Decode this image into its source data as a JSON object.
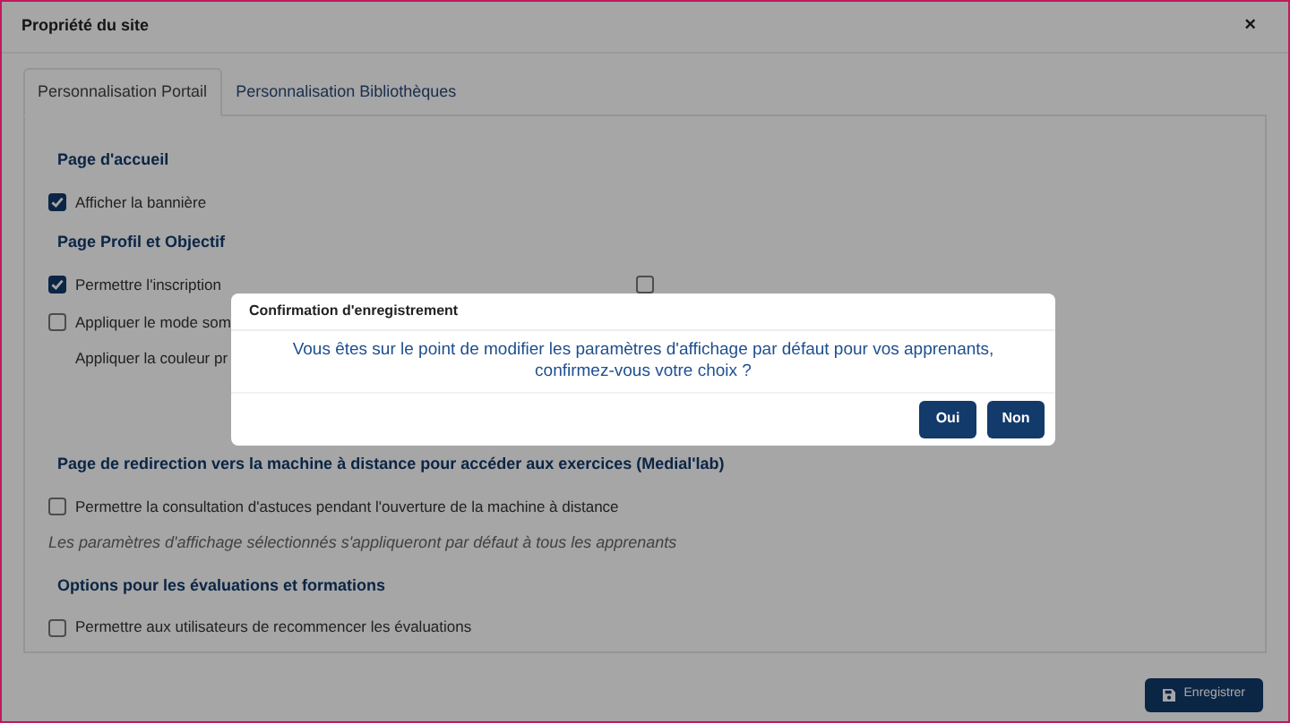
{
  "dialog": {
    "title": "Propriété du site",
    "close": "×"
  },
  "tabs": [
    {
      "label": "Personnalisation Portail",
      "selected": true
    },
    {
      "label": "Personnalisation Bibliothèques",
      "selected": false
    }
  ],
  "sections": [
    {
      "heading": "Page d'accueil",
      "items": [
        {
          "kind": "checkbox",
          "label": "Afficher la bannière",
          "checked": true
        }
      ]
    },
    {
      "heading": "Page Profil et Objectif",
      "items": [
        {
          "kind": "checkbox-row",
          "cells": [
            {
              "label": "Permettre l'inscription",
              "checked": true
            },
            {
              "checked": false
            }
          ]
        },
        {
          "kind": "checkbox",
          "label": "Appliquer le mode som",
          "checked": false
        },
        {
          "kind": "subtext",
          "text": "Appliquer la couleur pr"
        }
      ]
    },
    {
      "heading": "Page de redirection vers la machine à distance pour accéder aux exercices (Medial'lab)",
      "items": [
        {
          "kind": "checkbox",
          "label": "Permettre la consultation d'astuces pendant l'ouverture de la machine à distance",
          "checked": false
        },
        {
          "kind": "note",
          "text": "Les paramètres d'affichage sélectionnés s'appliqueront par défaut à tous les apprenants"
        }
      ]
    },
    {
      "heading": "Options pour les évaluations et formations",
      "items": [
        {
          "kind": "checkbox",
          "label": "Permettre aux utilisateurs de recommencer les évaluations",
          "checked": false
        }
      ]
    }
  ],
  "save_button": "Enregistrer",
  "confirm": {
    "title": "Confirmation d'enregistrement",
    "message": "Vous êtes sur le point de modifier les paramètres d'affichage par défaut pour vos apprenants, confirmez-vous votre choix ?",
    "buttons": [
      "Oui",
      "Non"
    ]
  }
}
